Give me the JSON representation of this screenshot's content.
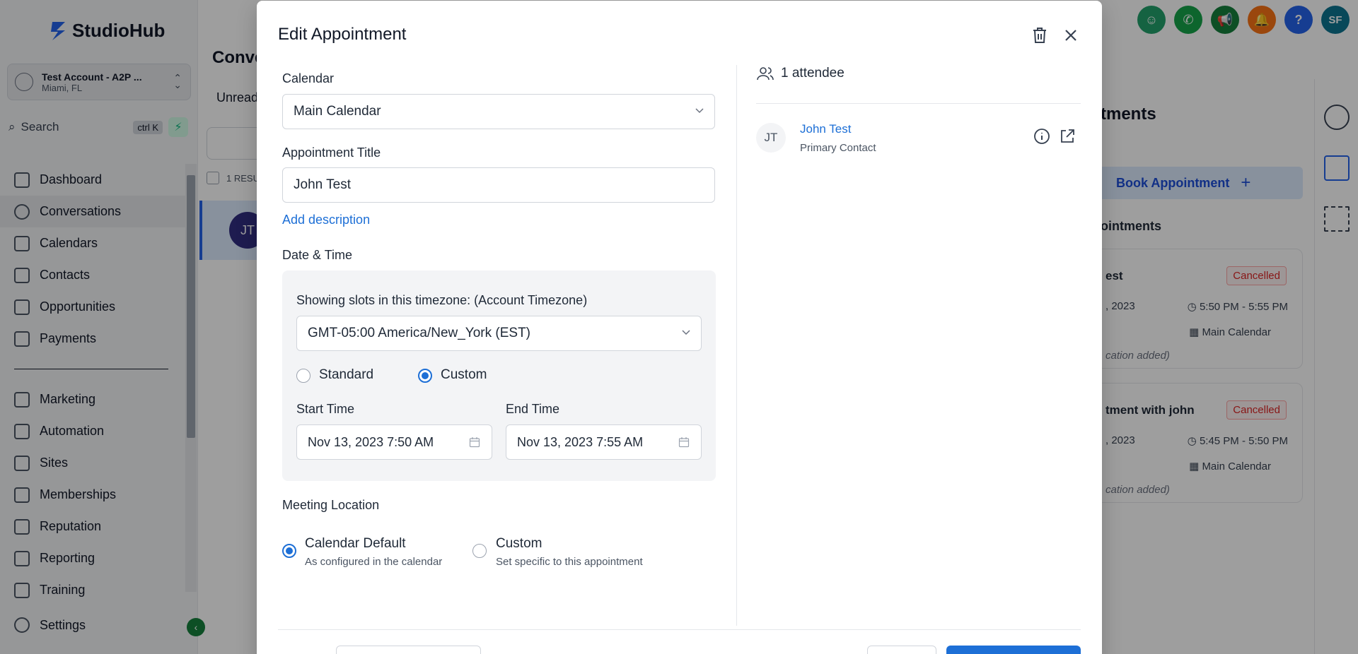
{
  "app": {
    "logo_text": "StudioHub",
    "account": {
      "name": "Test Account - A2P ...",
      "location": "Miami, FL"
    },
    "search": {
      "label": "Search",
      "shortcut": "ctrl K"
    },
    "nav": [
      {
        "label": "Dashboard",
        "icon": "dashboard-icon"
      },
      {
        "label": "Conversations",
        "icon": "chat-icon",
        "active": true
      },
      {
        "label": "Calendars",
        "icon": "calendar-icon"
      },
      {
        "label": "Contacts",
        "icon": "contacts-icon"
      },
      {
        "label": "Opportunities",
        "icon": "filter-icon"
      },
      {
        "label": "Payments",
        "icon": "receipt-icon"
      }
    ],
    "nav2": [
      {
        "label": "Marketing",
        "icon": "send-icon"
      },
      {
        "label": "Automation",
        "icon": "automation-icon"
      },
      {
        "label": "Sites",
        "icon": "sites-icon"
      },
      {
        "label": "Memberships",
        "icon": "memberships-icon"
      },
      {
        "label": "Reputation",
        "icon": "star-icon"
      },
      {
        "label": "Reporting",
        "icon": "chart-icon"
      },
      {
        "label": "Training",
        "icon": "book-icon"
      }
    ],
    "settings_label": "Settings",
    "conversations": {
      "title": "Conve",
      "tab": "Unread",
      "results": "1 RESU",
      "row_initials": "JT"
    },
    "topbar_icons": [
      {
        "name": "bot-icon",
        "color": "#22a06b",
        "text": ""
      },
      {
        "name": "phone-icon",
        "color": "#16a34a",
        "text": ""
      },
      {
        "name": "megaphone-icon",
        "color": "#15803d",
        "text": ""
      },
      {
        "name": "bell-icon",
        "color": "#f97316",
        "text": ""
      },
      {
        "name": "help-icon",
        "color": "#2563eb",
        "text": "?"
      },
      {
        "name": "user-avatar",
        "color": "#0e7490",
        "text": "SF"
      }
    ],
    "right_panel": {
      "title": "tments",
      "book_label": "Book Appointment",
      "subtitle": "ointments",
      "cards": [
        {
          "title": "est",
          "status": "Cancelled",
          "date": ", 2023",
          "time": "5:50 PM - 5:55 PM",
          "calendar": "Main Calendar",
          "location": "cation added)"
        },
        {
          "title": "tment with john",
          "status": "Cancelled",
          "date": ", 2023",
          "time": "5:45 PM - 5:50 PM",
          "calendar": "Main Calendar",
          "location": "cation added)"
        }
      ]
    }
  },
  "modal": {
    "title": "Edit Appointment",
    "calendar_label": "Calendar",
    "calendar_value": "Main Calendar",
    "title_label": "Appointment Title",
    "title_value": "John Test",
    "add_description": "Add description",
    "datetime_label": "Date & Time",
    "timezone_label": "Showing slots in this timezone: (Account Timezone)",
    "timezone_value": "GMT-05:00 America/New_York (EST)",
    "slot_mode": {
      "standard": "Standard",
      "custom": "Custom",
      "selected": "custom"
    },
    "start_label": "Start Time",
    "start_value": "Nov 13, 2023 7:50 AM",
    "end_label": "End Time",
    "end_value": "Nov 13, 2023 7:55 AM",
    "location_label": "Meeting Location",
    "location_options": {
      "default_title": "Calendar Default",
      "default_sub": "As configured in the calendar",
      "custom_title": "Custom",
      "custom_sub": "Set specific to this appointment",
      "selected": "default"
    },
    "attendees": {
      "count_label": "1 attendee",
      "list": [
        {
          "initials": "JT",
          "name": "John Test",
          "role": "Primary Contact"
        }
      ]
    }
  },
  "colors": {
    "accent": "#1d6fd6",
    "danger": "#dc2626"
  }
}
